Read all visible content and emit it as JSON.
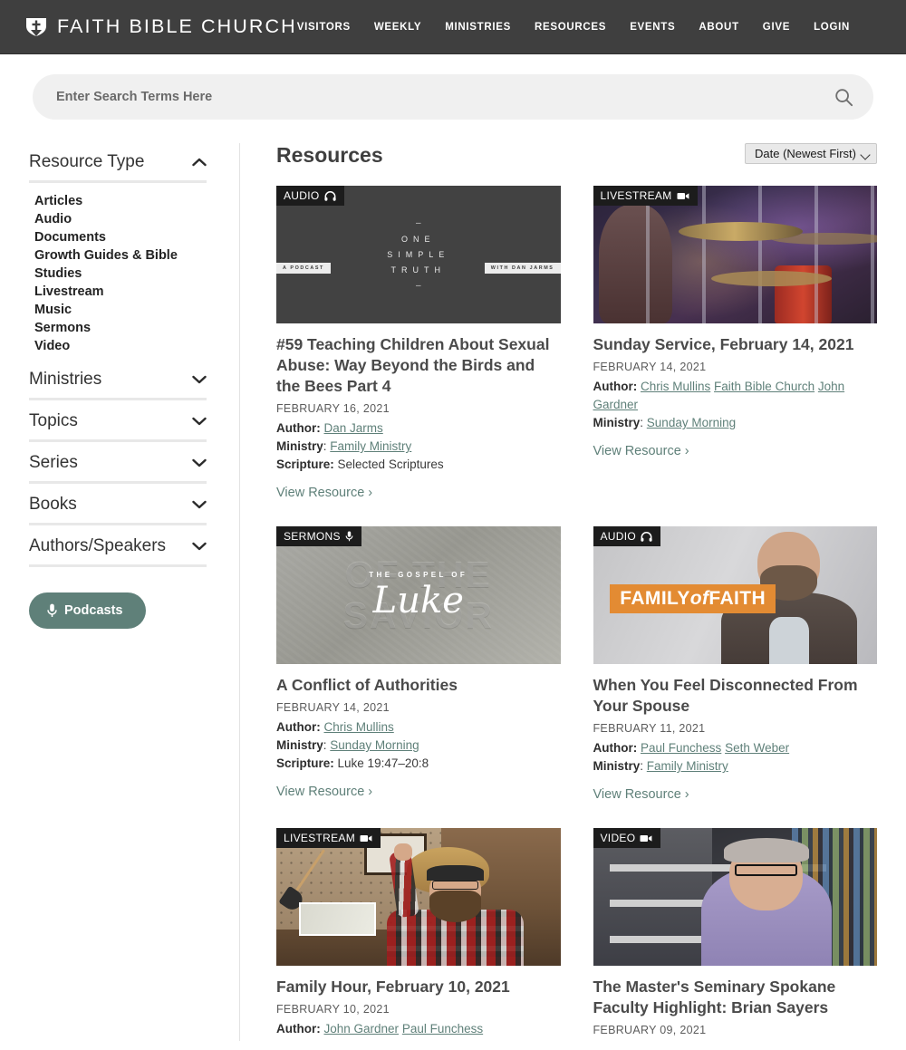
{
  "header": {
    "brand": "FAITH BIBLE CHURCH",
    "logo_icon": "church-shield-cross-icon",
    "nav": [
      {
        "label": "VISITORS"
      },
      {
        "label": "WEEKLY"
      },
      {
        "label": "MINISTRIES"
      },
      {
        "label": "RESOURCES"
      },
      {
        "label": "EVENTS"
      },
      {
        "label": "ABOUT"
      },
      {
        "label": "GIVE"
      },
      {
        "label": "LOGIN"
      }
    ]
  },
  "search": {
    "placeholder": "Enter Search Terms Here",
    "value": "",
    "icon": "search-icon"
  },
  "sidebar": {
    "groups": [
      {
        "title": "Resource Type",
        "expanded": true,
        "chevron": "chevron-up-icon",
        "options": [
          "Articles",
          "Audio",
          "Documents",
          "Growth Guides & Bible Studies",
          "Livestream",
          "Music",
          "Sermons",
          "Video"
        ]
      },
      {
        "title": "Ministries",
        "expanded": false,
        "chevron": "chevron-down-icon",
        "options": []
      },
      {
        "title": "Topics",
        "expanded": false,
        "chevron": "chevron-down-icon",
        "options": []
      },
      {
        "title": "Series",
        "expanded": false,
        "chevron": "chevron-down-icon",
        "options": []
      },
      {
        "title": "Books",
        "expanded": false,
        "chevron": "chevron-down-icon",
        "options": []
      },
      {
        "title": "Authors/Speakers",
        "expanded": false,
        "chevron": "chevron-down-icon",
        "options": []
      }
    ],
    "podcasts_button": {
      "label": "Podcasts",
      "icon": "microphone-icon",
      "color": "#5f8079"
    }
  },
  "main": {
    "title": "Resources",
    "sort": {
      "selected": "Date (Newest First)",
      "options": [
        "Date (Newest First)"
      ]
    },
    "view_resource_label": "View Resource",
    "labels": {
      "author": "Author:",
      "ministry": "Ministry",
      "scripture": "Scripture:"
    },
    "cards": [
      {
        "badge": "AUDIO",
        "badge_icon": "headphones-icon",
        "art": "one-simple-truth-podcast",
        "art_text": {
          "line1": "ONE",
          "line2": "SIMPLE",
          "line3": "TRUTH",
          "tag_left": "A PODCAST",
          "tag_right": "WITH DAN JARMS",
          "dash": "–"
        },
        "title": "#59 Teaching Children About Sexual Abuse: Way Beyond the Birds and the Bees Part 4",
        "date": "FEBRUARY 16, 2021",
        "authors": [
          "Dan Jarms"
        ],
        "ministries": [
          "Family Ministry"
        ],
        "scripture": "Selected Scriptures",
        "has_view_resource": true
      },
      {
        "badge": "LIVESTREAM",
        "badge_icon": "video-camera-icon",
        "art": "drummer-stage",
        "title": "Sunday Service, February 14, 2021",
        "date": "FEBRUARY 14, 2021",
        "authors": [
          "Chris Mullins",
          "Faith Bible Church",
          "John Gardner"
        ],
        "ministries": [
          "Sunday Morning"
        ],
        "scripture": "",
        "has_view_resource": true
      },
      {
        "badge": "SERMONS",
        "badge_icon": "microphone-icon",
        "art": "gospel-of-luke",
        "art_text": {
          "kicker": "THE GOSPEL OF",
          "script": "Luke",
          "ghost_line1": "OF THE",
          "ghost_line2": "SAVIOR"
        },
        "title": "A Conflict of Authorities",
        "date": "FEBRUARY 14, 2021",
        "authors": [
          "Chris Mullins"
        ],
        "ministries": [
          "Sunday Morning"
        ],
        "scripture": "Luke 19:47–20:8",
        "has_view_resource": true
      },
      {
        "badge": "AUDIO",
        "badge_icon": "headphones-icon",
        "art": "family-of-faith",
        "art_text": {
          "banner_a": "FAMILY",
          "banner_b": "of",
          "banner_c": "FAITH"
        },
        "title": "When You Feel Disconnected From Your Spouse",
        "date": "FEBRUARY 11, 2021",
        "authors": [
          "Paul Funchess",
          "Seth Weber"
        ],
        "ministries": [
          "Family Ministry"
        ],
        "scripture": "",
        "has_view_resource": true
      },
      {
        "badge": "LIVESTREAM",
        "badge_icon": "video-camera-icon",
        "art": "workshop-thumbs-up",
        "title": "Family Hour, February 10, 2021",
        "date": "FEBRUARY 10, 2021",
        "authors": [
          "John Gardner",
          "Paul Funchess"
        ],
        "ministries": [],
        "scripture": "",
        "has_view_resource": false
      },
      {
        "badge": "VIDEO",
        "badge_icon": "video-camera-icon",
        "art": "brian-sayers-interview",
        "title": "The Master's Seminary Spokane Faculty Highlight: Brian Sayers",
        "date": "FEBRUARY 09, 2021",
        "authors": [],
        "ministries": [],
        "scripture": "",
        "has_view_resource": false
      }
    ]
  },
  "colors": {
    "header_bg": "#3f3f3f",
    "accent": "#5f8079",
    "badge_bg": "#1c1c1c",
    "text": "#3d3d3d"
  }
}
